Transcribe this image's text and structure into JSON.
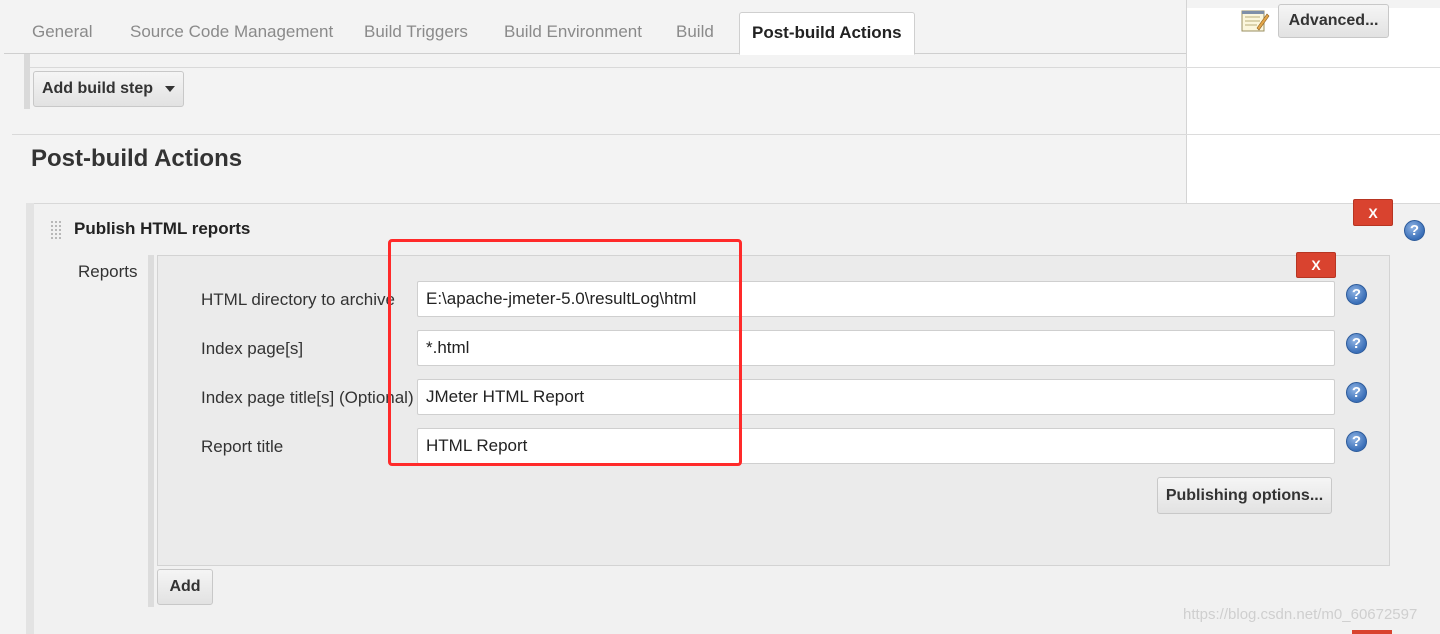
{
  "tabs": [
    {
      "label": "General"
    },
    {
      "label": "Source Code Management"
    },
    {
      "label": "Build Triggers"
    },
    {
      "label": "Build Environment"
    },
    {
      "label": "Build"
    },
    {
      "label": "Post-build Actions"
    }
  ],
  "active_tab": "Post-build Actions",
  "right_panel": {
    "advanced_label": "Advanced...",
    "icon": "notepad-icon"
  },
  "build": {
    "add_build_step_label": "Add build step"
  },
  "post_build": {
    "section_title": "Post-build Actions",
    "publisher": {
      "title": "Publish HTML reports",
      "delete_label": "X",
      "reports_label": "Reports",
      "report": {
        "delete_label": "X",
        "fields": [
          {
            "label": "HTML directory to archive",
            "value": "E:\\apache-jmeter-5.0\\resultLog\\html"
          },
          {
            "label": "Index page[s]",
            "value": "*.html"
          },
          {
            "label": "Index page title[s] (Optional)",
            "value": "JMeter HTML Report"
          },
          {
            "label": "Report title",
            "value": "HTML Report"
          }
        ],
        "publishing_options_label": "Publishing options..."
      },
      "add_label": "Add"
    }
  },
  "help_glyph": "?",
  "watermark": "https://blog.csdn.net/m0_60672597",
  "colors": {
    "delete_red": "#d9432f",
    "highlight_red": "#ff2a2a",
    "help_blue": "#3a6fb8"
  }
}
